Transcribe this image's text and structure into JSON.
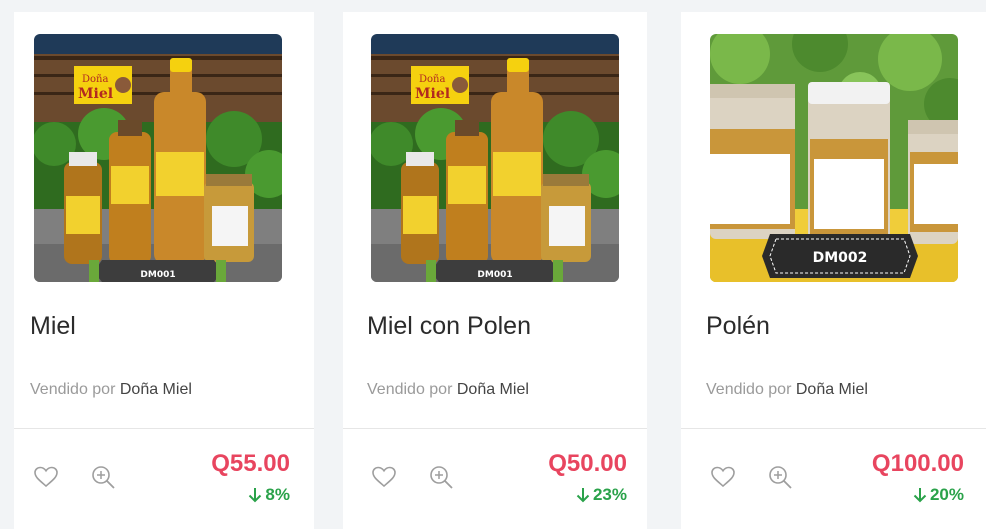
{
  "products": [
    {
      "code": "DM001",
      "logo_line1": "Doña",
      "logo_line2": "Miel",
      "name": "Miel",
      "seller_prefix": "Vendido por",
      "seller_name": "Doña Miel",
      "price": "Q55.00",
      "discount": "8%"
    },
    {
      "code": "DM001",
      "logo_line1": "Doña",
      "logo_line2": "Miel",
      "name": "Miel con Polen",
      "seller_prefix": "Vendido por",
      "seller_name": "Doña Miel",
      "price": "Q50.00",
      "discount": "23%"
    },
    {
      "code": "DM002",
      "name": "Polén",
      "seller_prefix": "Vendido por",
      "seller_name": "Doña Miel",
      "price": "Q100.00",
      "discount": "20%"
    }
  ],
  "colors": {
    "price": "#e8455f",
    "discount": "#2aa24a",
    "muted_text": "#9a9a9a"
  },
  "icons": {
    "favorite": "heart-outline-icon",
    "zoom": "zoom-in-icon",
    "discount": "arrow-down-icon"
  }
}
